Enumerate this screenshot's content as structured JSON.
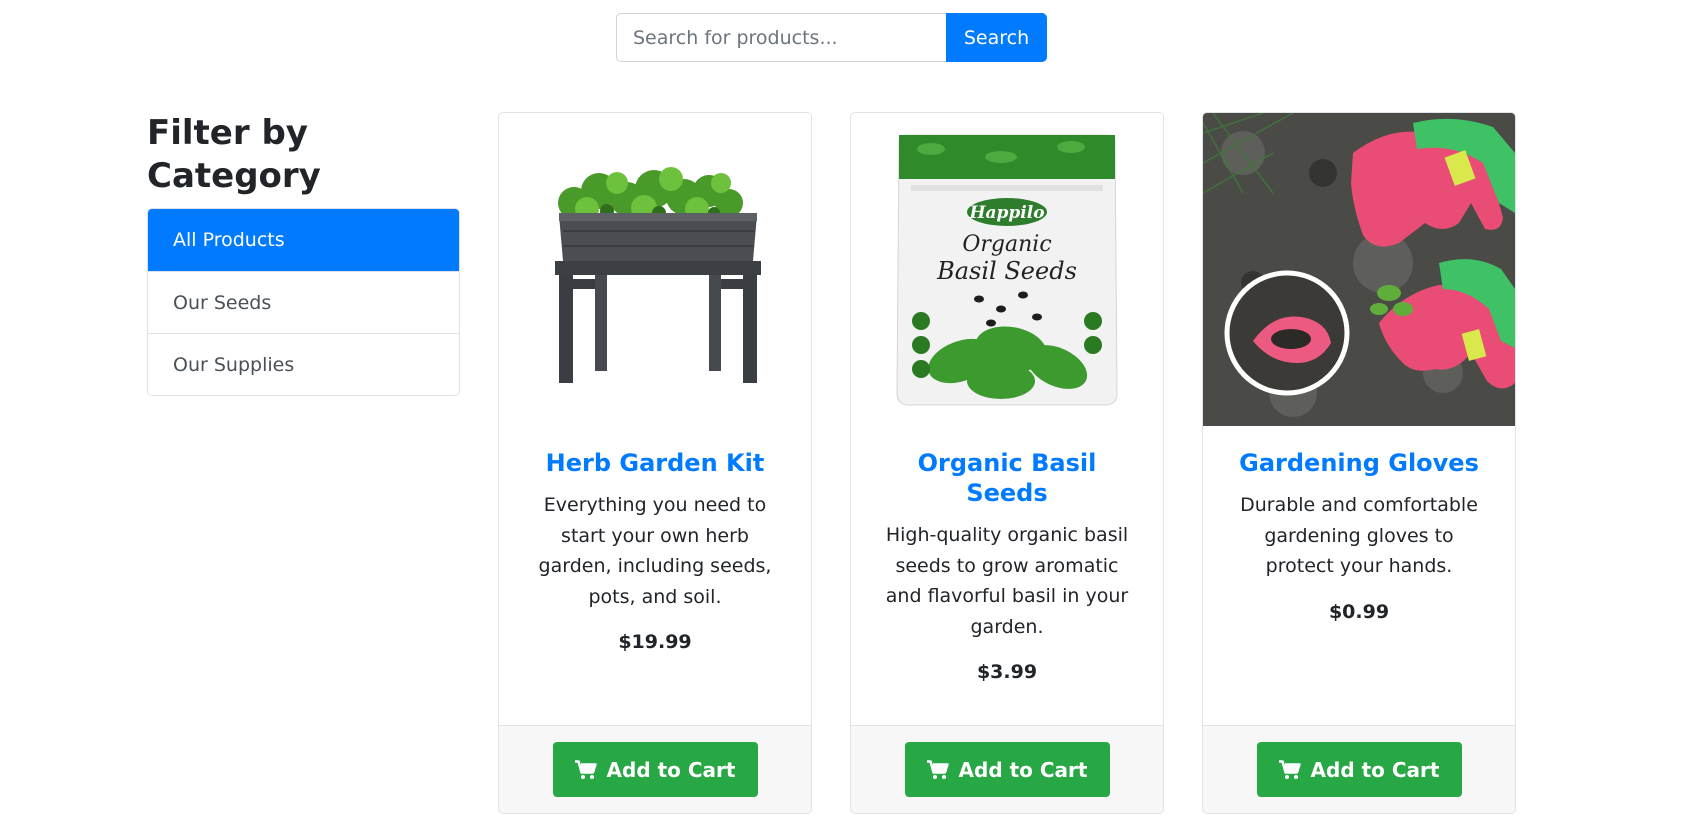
{
  "search": {
    "placeholder": "Search for products...",
    "button_label": "Search"
  },
  "sidebar": {
    "title": "Filter by Category",
    "categories": [
      {
        "label": "All Products",
        "active": true
      },
      {
        "label": "Our Seeds",
        "active": false
      },
      {
        "label": "Our Supplies",
        "active": false
      }
    ]
  },
  "products": [
    {
      "name": "Herb Garden Kit",
      "description": "Everything you need to start your own herb garden, including seeds, pots, and soil.",
      "price": "$19.99",
      "image": "herb-planter-image",
      "cart_label": "Add to Cart"
    },
    {
      "name": "Organic Basil Seeds",
      "description": "High-quality organic basil seeds to grow aromatic and flavorful basil in your garden.",
      "price": "$3.99",
      "image": "basil-seed-pouch-image",
      "cart_label": "Add to Cart",
      "package_brand": "Happilo",
      "package_title": "Organic Basil Seeds"
    },
    {
      "name": "Gardening Gloves",
      "description": "Durable and comfortable gardening gloves to protect your hands.",
      "price": "$0.99",
      "image": "gardening-gloves-image",
      "cart_label": "Add to Cart"
    }
  ],
  "colors": {
    "primary": "#007bff",
    "success": "#28a745",
    "text": "#212529",
    "border": "#dee2e6",
    "footer_bg": "#f7f7f7"
  },
  "icons": {
    "cart": "shopping-cart-icon"
  }
}
